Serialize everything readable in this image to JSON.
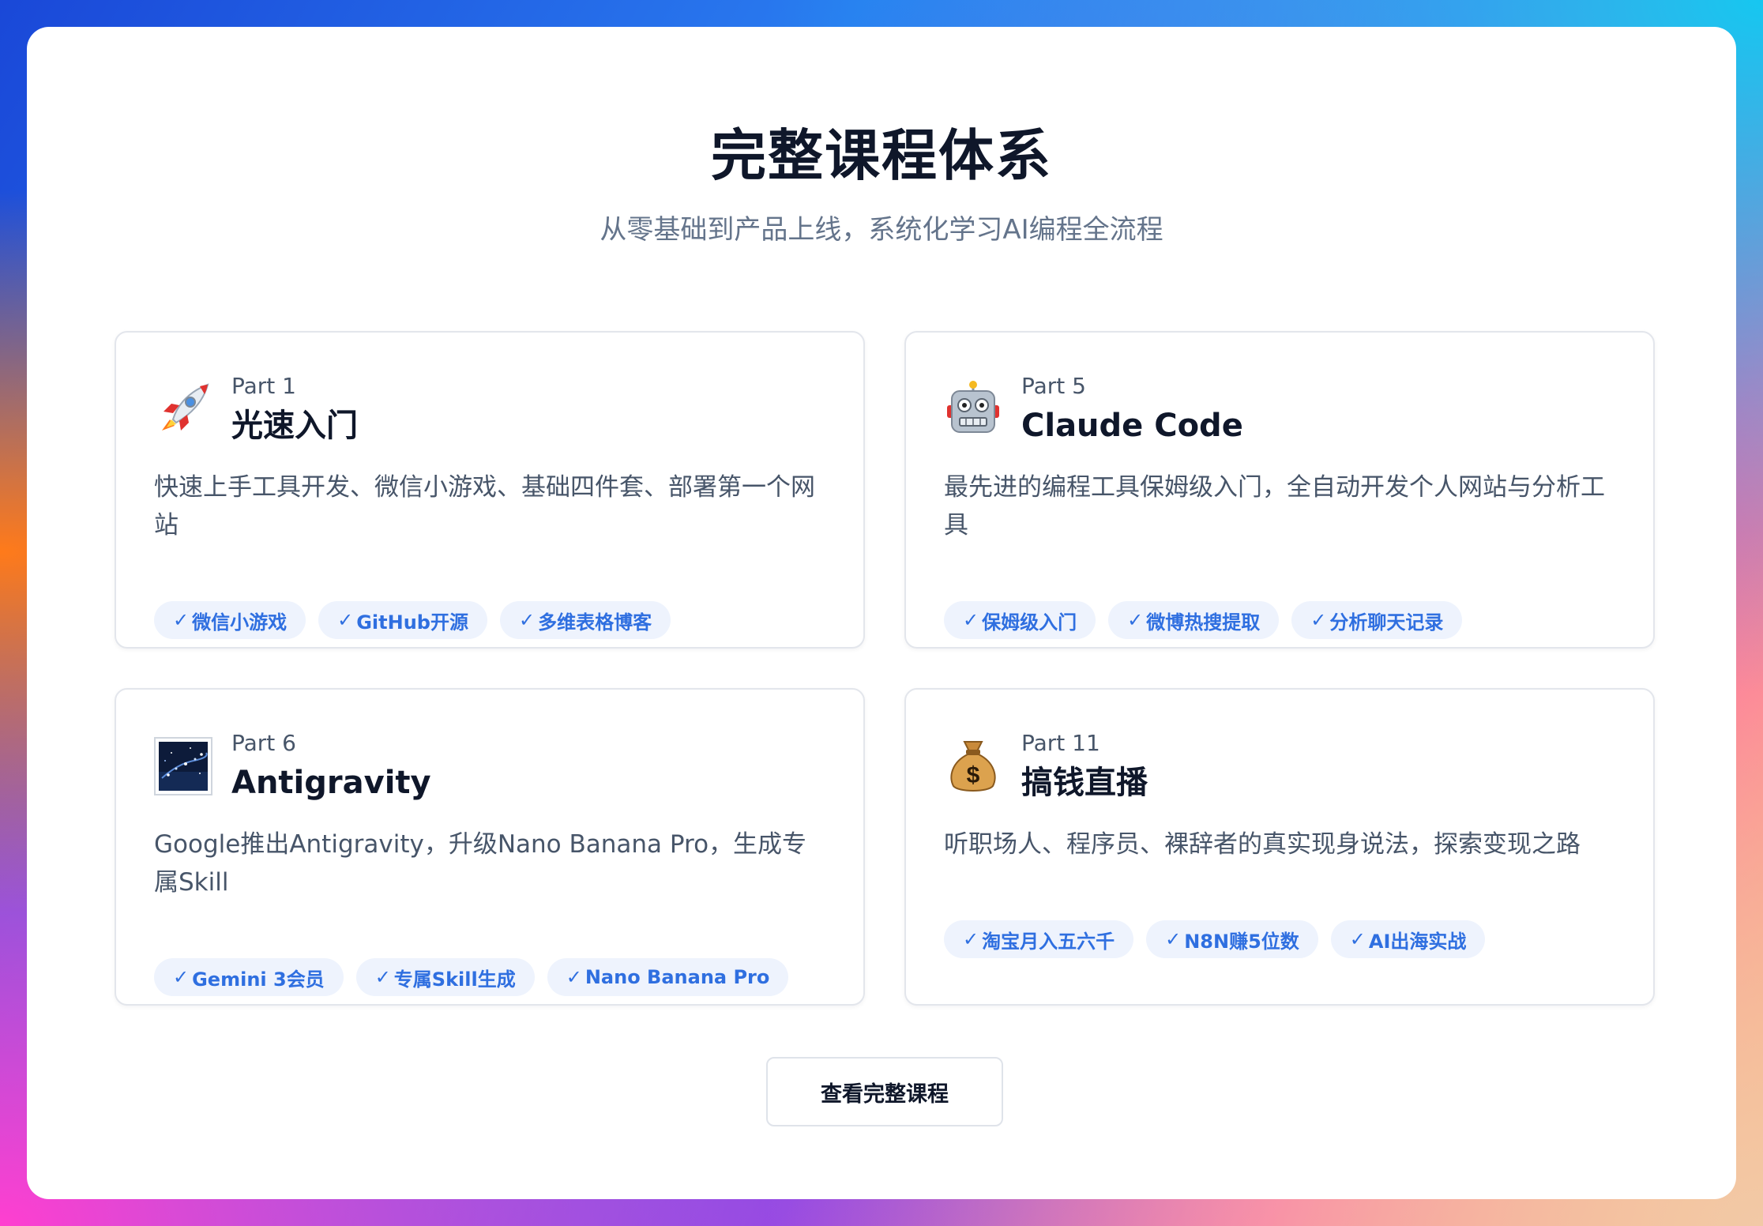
{
  "header": {
    "title": "完整课程体系",
    "subtitle": "从零基础到产品上线，系统化学习AI编程全流程"
  },
  "cards": [
    {
      "icon": "rocket-icon",
      "part": "Part 1",
      "title": "光速入门",
      "description": "快速上手工具开发、微信小游戏、基础四件套、部署第一个网站",
      "tags": [
        "微信小游戏",
        "GitHub开源",
        "多维表格博客"
      ]
    },
    {
      "icon": "robot-icon",
      "part": "Part 5",
      "title": "Claude Code",
      "description": "最先进的编程工具保姆级入门，全自动开发个人网站与分析工具",
      "tags": [
        "保姆级入门",
        "微博热搜提取",
        "分析聊天记录"
      ]
    },
    {
      "icon": "galaxy-icon",
      "part": "Part 6",
      "title": "Antigravity",
      "description": "Google推出Antigravity，升级Nano Banana Pro，生成专属Skill",
      "tags": [
        "Gemini 3会员",
        "专属Skill生成",
        "Nano Banana Pro"
      ]
    },
    {
      "icon": "money-bag-icon",
      "part": "Part 11",
      "title": "搞钱直播",
      "description": "听职场人、程序员、裸辞者的真实现身说法，探索变现之路",
      "tags": [
        "淘宝月入五六千",
        "N8N赚5位数",
        "AI出海实战"
      ]
    }
  ],
  "check_glyph": "✓",
  "cta": {
    "label": "查看完整课程"
  },
  "colors": {
    "tag_text": "#2f6fe0",
    "tag_bg": "#eef3fd",
    "title": "#0f172a",
    "muted": "#64748b"
  }
}
